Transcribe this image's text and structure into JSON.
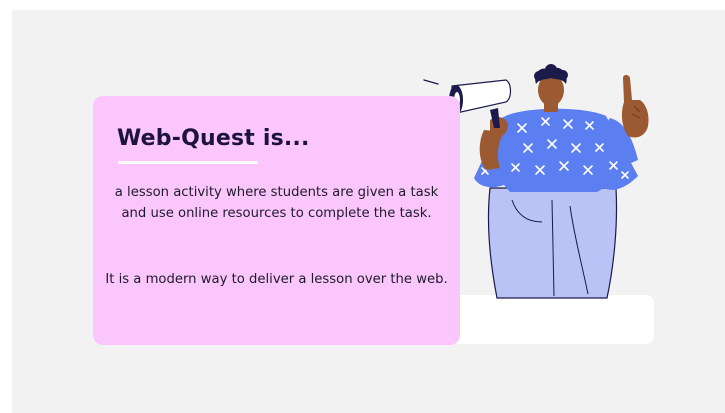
{
  "slide": {
    "title": "Web-Quest is...",
    "paragraph_1": "a lesson activity where students are given a task and use online resources to complete the task.",
    "paragraph_2": "It is a modern way to deliver a lesson over the web."
  },
  "colors": {
    "background": "#f2f2f2",
    "card_pink": "#fbc6fb",
    "title_navy": "#1d1240",
    "shirt_blue": "#5b7ef0",
    "pants_lavender": "#b9c3f5",
    "skin": "#9c5a32",
    "hair": "#1b1a4a"
  },
  "illustration": {
    "subject": "person-with-megaphone",
    "icons": [
      "megaphone-icon",
      "raised-finger-hand"
    ]
  }
}
